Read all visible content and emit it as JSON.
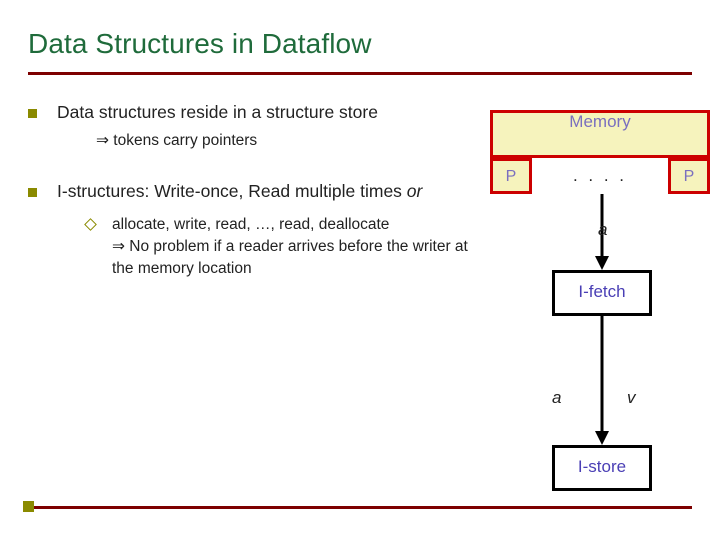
{
  "slide": {
    "title": "Data Structures in Dataflow",
    "bullets": {
      "first": "Data structures reside in a structure store",
      "first_sub": "⇒ tokens carry pointers",
      "second_main": "I-structures: Write-once, Read multiple times ",
      "second_italic": "or",
      "third": "allocate, write, read, …, read, deallocate",
      "third_sub": "⇒ No problem if a reader arrives before the writer at the memory location"
    }
  },
  "diagram": {
    "memory_label": "Memory",
    "p_left": "P",
    "p_right": "P",
    "dots": ". . . .",
    "ifetch": "I-fetch",
    "istore": "I-store",
    "label_a_top": "a",
    "label_a_bottom": "a",
    "label_v": "v"
  },
  "colors": {
    "title": "#1f6b3b",
    "rule": "#7d0000",
    "bullet_marker": "#8a8a00",
    "box_border_red": "#cc0000",
    "box_fill": "#f6f3bd",
    "memory_text": "#7a6fbf",
    "istruct_text": "#4a3fb5",
    "body_text": "#222222"
  }
}
